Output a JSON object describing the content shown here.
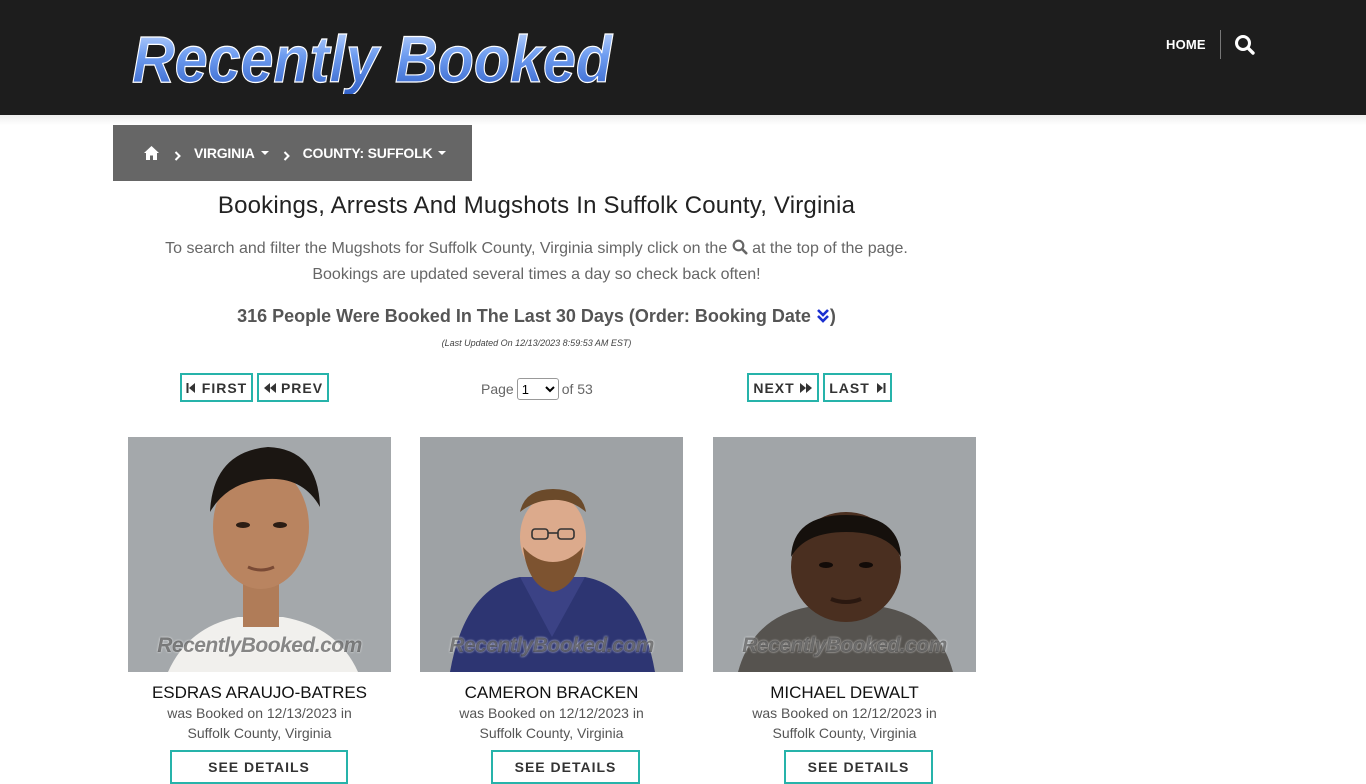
{
  "header": {
    "logo_text": "Recently Booked",
    "nav_home": "HOME"
  },
  "breadcrumb": {
    "state": "VIRGINIA",
    "county": "COUNTY: SUFFOLK"
  },
  "page_title": "Bookings, Arrests And Mugshots In Suffolk County, Virginia",
  "intro": {
    "line1_before": "To search and filter the Mugshots for Suffolk County, Virginia simply click on the",
    "line1_after": "at the top of the page.",
    "line2": "Bookings are updated several times a day so check back often!"
  },
  "count_line": {
    "text": "316 People Were Booked In The Last 30 Days (Order: Booking Date",
    "close": ")"
  },
  "last_updated": "(Last Updated On 12/13/2023 8:59:53 AM EST)",
  "pagination": {
    "first": "FIRST",
    "prev": "PREV",
    "next": "NEXT",
    "last": "LAST",
    "page_label": "Page",
    "current_page": "1",
    "of_label": "of 53"
  },
  "bookings": [
    {
      "name": "ESDRAS ARAUJO-BATRES",
      "booked_line": "was Booked on 12/13/2023 in",
      "location": "Suffolk County, Virginia",
      "watermark": "RecentlyBooked.com",
      "button": "SEE DETAILS"
    },
    {
      "name": "CAMERON BRACKEN",
      "booked_line": "was Booked on 12/12/2023 in",
      "location": "Suffolk County, Virginia",
      "watermark": "RecentlyBooked.com",
      "button": "SEE DETAILS"
    },
    {
      "name": "MICHAEL DEWALT",
      "booked_line": "was Booked on 12/12/2023 in",
      "location": "Suffolk County, Virginia",
      "watermark": "RecentlyBooked.com",
      "button": "SEE DETAILS"
    }
  ],
  "colors": {
    "header_bg": "#1d1d1d",
    "breadcrumb_bg": "#666666",
    "accent_border": "#26b3aa",
    "logo_blue": "#5b8fe6"
  }
}
